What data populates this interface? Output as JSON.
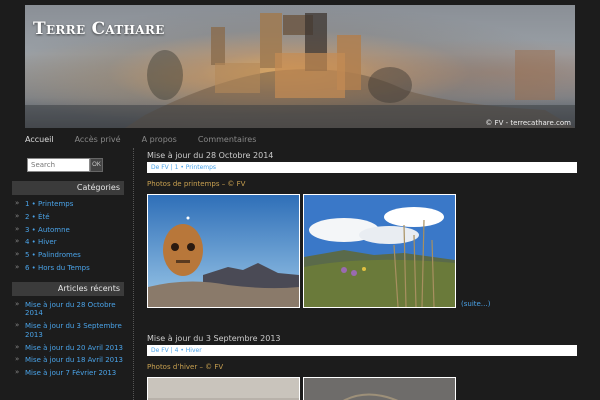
{
  "site": {
    "title": "Terre Cathare",
    "credit": "© FV - terrecathare.com"
  },
  "nav": [
    {
      "label": "Accueil",
      "active": true
    },
    {
      "label": "Accès privé",
      "active": false
    },
    {
      "label": "A propos",
      "active": false
    },
    {
      "label": "Commentaires",
      "active": false
    }
  ],
  "search": {
    "placeholder": "Search",
    "button": "OK"
  },
  "categories": {
    "title": "Catégories",
    "items": [
      "1 • Printemps",
      "2 • Été",
      "3 • Automne",
      "4 • Hiver",
      "5 • Palindromes",
      "6 • Hors du Temps"
    ]
  },
  "recent": {
    "title": "Articles récents",
    "items": [
      "Mise à jour du 28 Octobre 2014",
      "Mise à jour du 3 Septembre 2013",
      "Mise à jour du 20 Avril 2013",
      "Mise à jour du 18 Avril 2013",
      "Mise à jour 7 Février 2013"
    ]
  },
  "posts": [
    {
      "title": "Mise à jour du 28 Octobre 2014",
      "meta": "De FV | 1 • Printemps",
      "caption": "Photos de printemps – © FV",
      "more": "(suite…)"
    },
    {
      "title": "Mise à jour du 3 Septembre 2013",
      "meta": "De FV | 4 • Hiver",
      "caption": "Photos d’hiver – © FV"
    }
  ],
  "colors": {
    "link": "#4aa3e8",
    "caption": "#c8a050",
    "sidebar_header": "#3b3b3b"
  }
}
